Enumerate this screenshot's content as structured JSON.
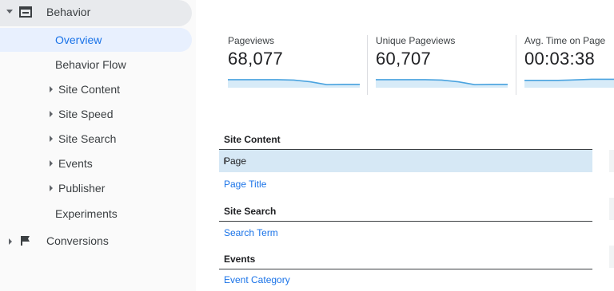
{
  "sidebar": {
    "behavior_label": "Behavior",
    "items": [
      {
        "label": "Overview"
      },
      {
        "label": "Behavior Flow"
      },
      {
        "label": "Site Content"
      },
      {
        "label": "Site Speed"
      },
      {
        "label": "Site Search"
      },
      {
        "label": "Events"
      },
      {
        "label": "Publisher"
      },
      {
        "label": "Experiments"
      }
    ],
    "conversions_label": "Conversions"
  },
  "metrics": [
    {
      "label": "Pageviews",
      "value": "68,077",
      "sparkline": [
        0.45,
        0.45,
        0.45,
        0.45,
        0.42,
        0.3,
        0.1,
        0.12,
        0.12
      ]
    },
    {
      "label": "Unique Pageviews",
      "value": "60,707",
      "sparkline": [
        0.45,
        0.45,
        0.45,
        0.45,
        0.42,
        0.3,
        0.1,
        0.12,
        0.12
      ]
    },
    {
      "label": "Avg. Time on Page",
      "value": "00:03:38",
      "sparkline": [
        0.4,
        0.4,
        0.4,
        0.4,
        0.42,
        0.45,
        0.48,
        0.48,
        0.48
      ]
    }
  ],
  "tables": {
    "site_content": {
      "header": "Site Content",
      "rows": [
        "Page",
        "Page Title"
      ]
    },
    "site_search": {
      "header": "Site Search",
      "rows": [
        "Search Term"
      ]
    },
    "events": {
      "header": "Events",
      "rows": [
        "Event Category"
      ]
    }
  },
  "colors": {
    "accent": "#1a73e8",
    "sparkline_line": "#4aa3df",
    "sparkline_fill": "#d7ebf8",
    "selected_row": "#d6e8f5"
  }
}
